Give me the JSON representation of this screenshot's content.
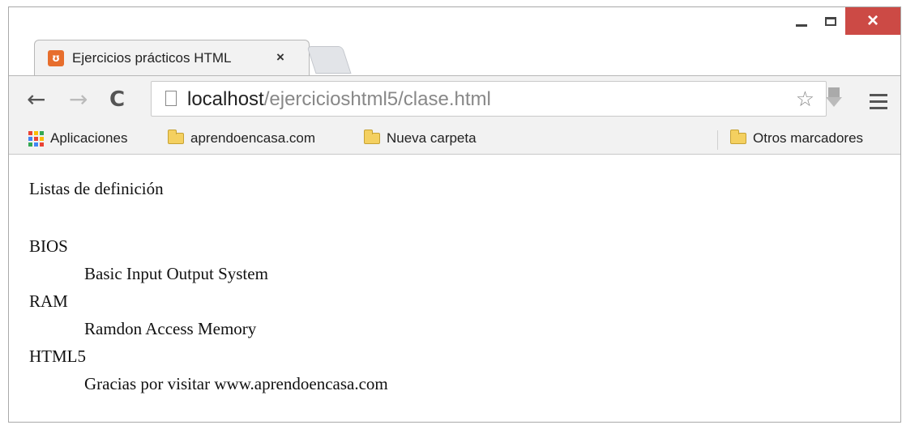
{
  "tab": {
    "title": "Ejercicios prácticos HTML",
    "close_glyph": "×",
    "favicon_glyph": "ʊ"
  },
  "window_controls": {
    "close_glyph": "×"
  },
  "toolbar": {
    "back_glyph": "←",
    "forward_glyph": "→",
    "reload_glyph": "C",
    "url_host": "localhost",
    "url_path": "/ejercicioshtml5/clase.html",
    "star_glyph": "☆"
  },
  "bookmarks": {
    "apps_label": "Aplicaciones",
    "items": [
      {
        "label": "aprendoencasa.com"
      },
      {
        "label": "Nueva carpeta"
      }
    ],
    "other_label": "Otros marcadores"
  },
  "content": {
    "heading": "Listas de definición",
    "definitions": [
      {
        "term": "BIOS",
        "description": "Basic Input Output System"
      },
      {
        "term": "RAM",
        "description": "Ramdon Access Memory"
      },
      {
        "term": "HTML5",
        "description": "Gracias por visitar www.aprendoencasa.com"
      }
    ]
  },
  "colors": {
    "close_button": "#cc4a45",
    "favicon": "#e76e2d",
    "folder": "#f4d060",
    "apps": [
      "#e94335",
      "#fbbc05",
      "#34a853",
      "#4285f4",
      "#ea4335",
      "#fbbc05",
      "#34a853",
      "#4285f4",
      "#ea4335"
    ]
  }
}
